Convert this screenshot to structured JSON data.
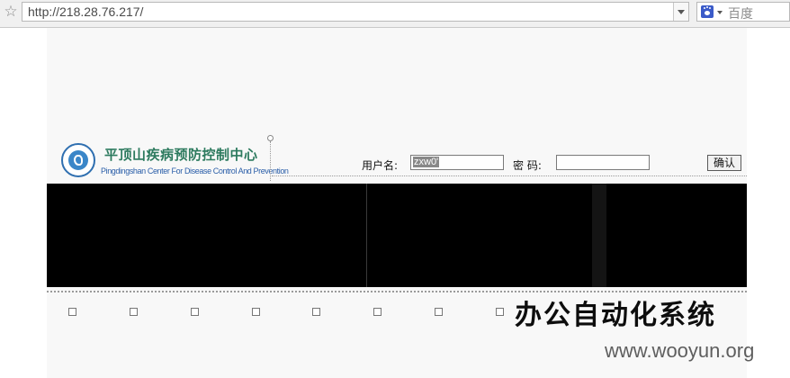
{
  "browser": {
    "url": "http://218.28.76.217/",
    "search_engine": "百度",
    "icons": [
      "star-icon",
      "dropdown-arrow-icon",
      "baidu-paw-icon"
    ]
  },
  "header": {
    "logo_cn": "平顶山疾病预防控制中心",
    "logo_en": "Pingdingshan Center For Disease Control And Prevention"
  },
  "login": {
    "username_label": "用户名:",
    "username_value": "zxw0'",
    "password_label": "密  码:",
    "password_value": "",
    "confirm_label": "确认"
  },
  "system_title": "办公自动化系统",
  "watermark": "www.wooyun.org",
  "colors": {
    "banner": "#000000",
    "page_bg": "#f8f8f8",
    "logo_cn": "#2c7a5e",
    "logo_en": "#2a5ea8"
  }
}
